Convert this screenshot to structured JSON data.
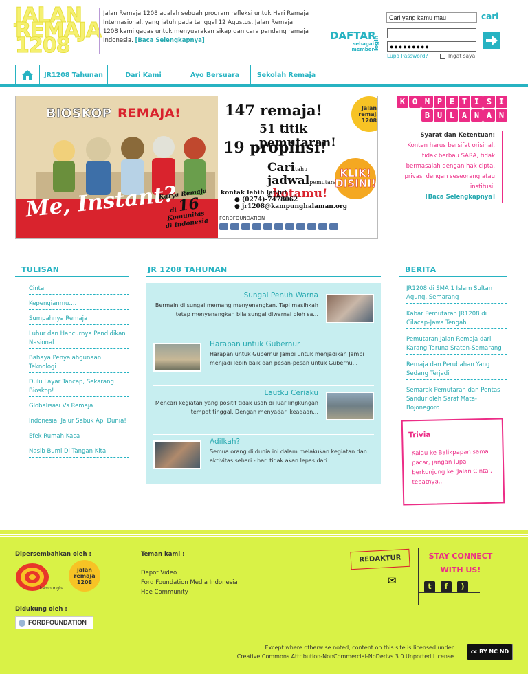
{
  "header": {
    "logo_text": [
      "JALAN",
      "REMAJA",
      "1208"
    ],
    "intro_text": "Jalan Remaja 1208 adalah sebuah program refleksi untuk Hari Remaja Internasional, yang jatuh pada tanggal 12 Agustus. Jalan Remaja 1208 kami gagas untuk menyuarakan sikap dan cara pandang remaja Indonesia.",
    "intro_more": "[Baca Selengkapnya]",
    "search_value": "Cari yang kamu mau",
    "search_button": "cari",
    "daftar_label": "DAFTAR",
    "daftar_sub": "sebagai member",
    "login_label": "login",
    "password_mask": "●●●●●●●●●",
    "forgot_label": "Lupa Password?",
    "remember_label": "Ingat saya"
  },
  "nav": {
    "items": [
      "JR1208 Tahunan",
      "Dari Kami",
      "Ayo Bersuara",
      "Sekolah Remaja"
    ]
  },
  "banner": {
    "left_title_1": "BIOSKOP",
    "left_title_2": "REMAJA!",
    "me_instant": "Me, Instant?",
    "karya_line1": "Karya Remaja",
    "karya_num": "16",
    "karya_line2": "di",
    "karya_line3": "Komunitas",
    "karya_line4": "di Indonesia",
    "r1": "147 remaja!",
    "r2": "51 titik pemutaran!",
    "r3": "19 propinsi!",
    "r4a": "Cari",
    "r4b": "tahu",
    "r4c": "jadwal",
    "r4d": "pemutaran di",
    "r4e": "kotamu!",
    "contact_label": "kontak lebih lanjut",
    "phone": "(0274)-7478062",
    "email": "jr1208@kampunghalaman.org",
    "jr_badge": "Jalan remaja 1208",
    "klik": "KLIK! DISINI!",
    "sponsor": "FORDFOUNDATION"
  },
  "kompetisi": {
    "title_row1": [
      "K",
      "O",
      "M",
      "P",
      "E",
      "T",
      "I",
      "S",
      "I"
    ],
    "title_row2": [
      "B",
      "U",
      "L",
      "A",
      "N",
      "A",
      "N"
    ],
    "heading": "Syarat dan Ketentuan:",
    "body": "Konten harus bersifat orisinal, tidak berbau SARA, tidak bermasalah dengan hak cipta, privasi dengan seseorang atau institusi.",
    "more": "[Baca Selengkapnya]"
  },
  "tulisan": {
    "title": "TULISAN",
    "items": [
      "Cinta",
      "Kepengianmu....",
      "Sumpahnya Remaja",
      "Luhur dan Hancurnya Pendidikan Nasional",
      "Bahaya Penyalahgunaan Teknologi",
      "Dulu Layar Tancap, Sekarang Bioskop!",
      "Globalisasi Vs Remaja",
      "Indonesia, Jalur Sabuk Api Dunia!",
      "Efek Rumah Kaca",
      "Nasib Bumi Di Tangan Kita"
    ]
  },
  "jr_tahunan": {
    "title": "JR 1208 TAHUNAN",
    "articles": [
      {
        "title": "Sungai Penuh Warna",
        "text": "Bermain di sungai memang menyenangkan. Tapi masihkah tetap menyenangkan bila sungai diwarnai oleh sa..."
      },
      {
        "title": "Harapan untuk Gubernur",
        "text": "Harapan untuk Gubernur Jambi untuk menjadikan Jambi menjadi lebih baik dan pesan-pesan untuk Gubernu..."
      },
      {
        "title": "Lautku Ceriaku",
        "text": "Mencari kegiatan yang positif tidak usah di luar lingkungan tempat tinggal. Dengan menyadari keadaan..."
      },
      {
        "title": "Adilkah?",
        "text": "Semua orang di dunia ini dalam melakukan kegiatan dan aktivitas sehari - hari tidak akan lepas dari ..."
      }
    ]
  },
  "berita": {
    "title": "BERITA",
    "items": [
      "JR1208 di SMA 1 Islam Sultan Agung, Semarang",
      "Kabar Pemutaran JR1208 di Cilacap-Jawa Tengah",
      "Pemutaran Jalan Remaja dari Karang Taruna Sraten-Semarang",
      "Remaja dan Perubahan Yang Sedang Terjadi",
      "Semarak Pemutaran dan Pentas Sandur oleh Saraf Mata-Bojonegoro"
    ]
  },
  "trivia": {
    "title": "Trivia",
    "text": "Kalau ke Balikpapan sama pacar, jangan lupa berkunjung ke 'Jalan Cinta', tepatnya..."
  },
  "footer": {
    "presented_by": "Dipersembahkan oleh :",
    "kampung_label": "kampunghalaman",
    "jr_badge": "jalan remaja 1208",
    "supported_by": "Didukung oleh :",
    "ford": "FORDFOUNDATION",
    "friends_title": "Teman kami :",
    "friends": [
      "Depot Video",
      "Ford Foundation Media Indonesia",
      "Hoe Community"
    ],
    "redaktur": "REDAKTUR",
    "stay_connect_1": "STAY CONNECT",
    "stay_connect_2": "WITH US!",
    "license_1": "Except where otherwise noted, content on this site is licensed under",
    "license_2": "Creative Commons Attribution-NonCommercial-NoDerivs 3.0 Unported License",
    "cc_badge": "cc BY NC ND"
  },
  "colors": {
    "accent_teal": "#27b3c2",
    "accent_pink": "#ec2c86",
    "footer_lime": "#d9f246",
    "logo_yellow": "#f5f070"
  }
}
